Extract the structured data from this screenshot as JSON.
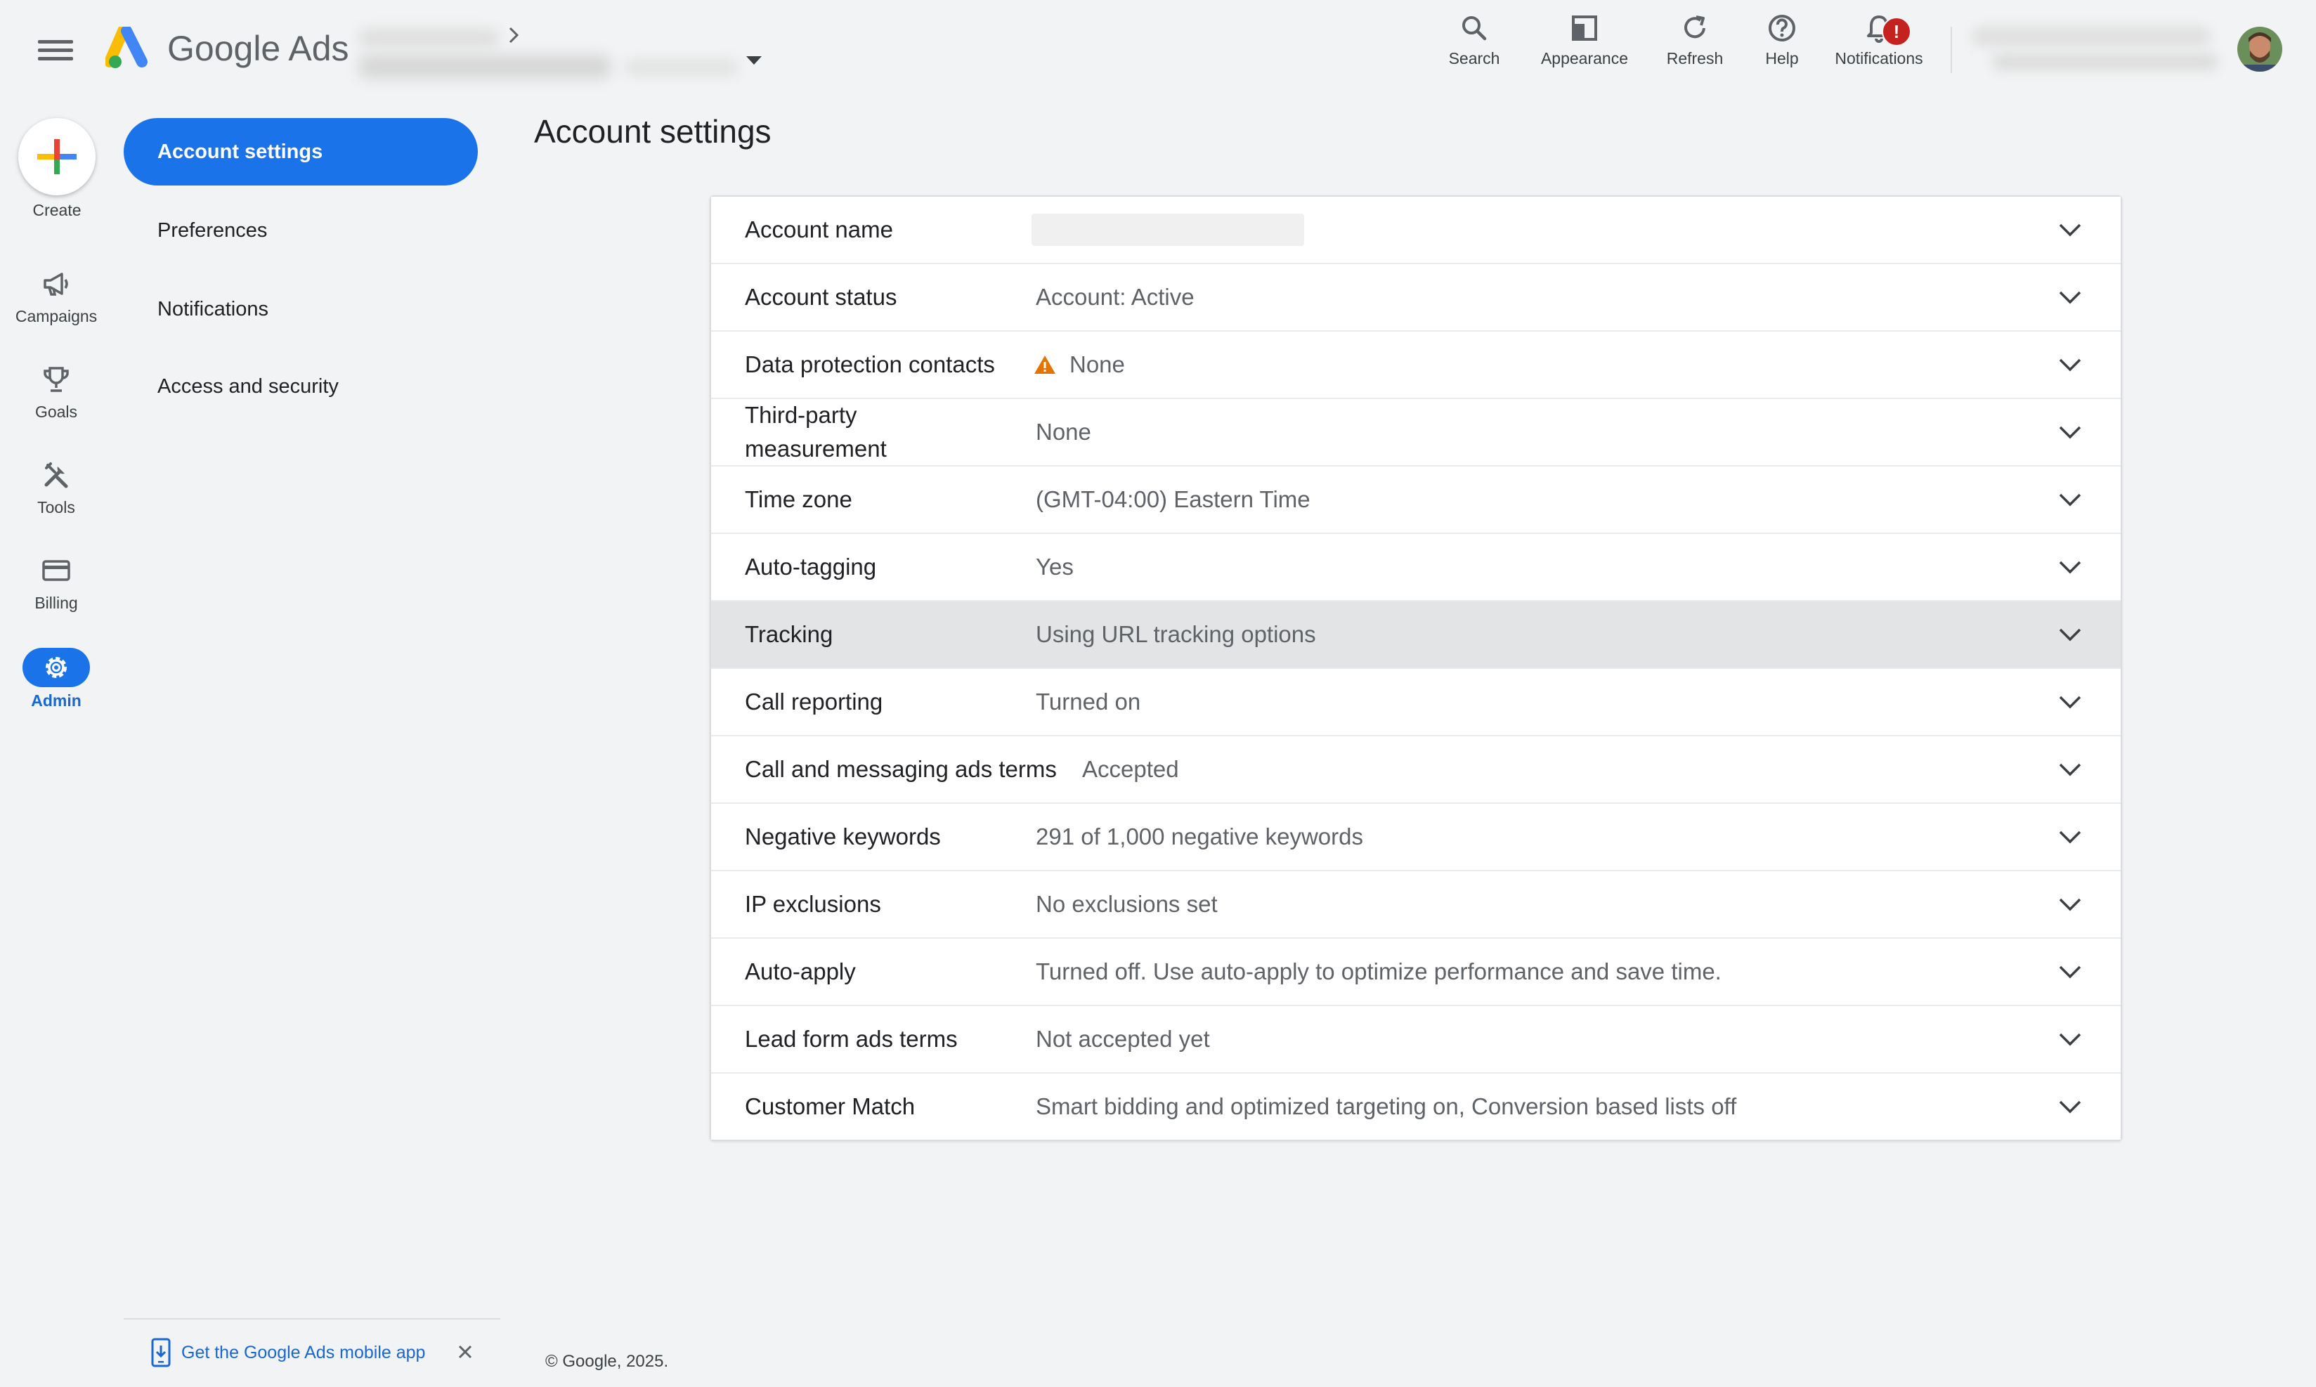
{
  "app": {
    "brand_google": "Google",
    "brand_ads": "Ads"
  },
  "toolbar": {
    "search_label": "Search",
    "appearance_label": "Appearance",
    "refresh_label": "Refresh",
    "help_label": "Help",
    "notifications_label": "Notifications",
    "notifications_badge": "!"
  },
  "rail": {
    "create": "Create",
    "campaigns": "Campaigns",
    "goals": "Goals",
    "tools": "Tools",
    "billing": "Billing",
    "admin": "Admin"
  },
  "subnav": {
    "account_settings": "Account settings",
    "preferences": "Preferences",
    "notifications": "Notifications",
    "access_security": "Access and security"
  },
  "main": {
    "title": "Account settings",
    "rows": [
      {
        "label": "Account name",
        "value": ""
      },
      {
        "label": "Account status",
        "value": "Account: Active"
      },
      {
        "label": "Data protection contacts",
        "value": "None"
      },
      {
        "label": "Third-party measurement",
        "value": "None"
      },
      {
        "label": "Time zone",
        "value": "(GMT-04:00) Eastern Time"
      },
      {
        "label": "Auto-tagging",
        "value": "Yes"
      },
      {
        "label": "Tracking",
        "value": "Using URL tracking options"
      },
      {
        "label": "Call reporting",
        "value": "Turned on"
      },
      {
        "label": "Call and messaging ads terms",
        "value": "Accepted"
      },
      {
        "label": "Negative keywords",
        "value": "291 of 1,000 negative keywords"
      },
      {
        "label": "IP exclusions",
        "value": "No exclusions set"
      },
      {
        "label": "Auto-apply",
        "value": "Turned off. Use auto-apply to optimize performance and save time."
      },
      {
        "label": "Lead form ads terms",
        "value": "Not accepted yet"
      },
      {
        "label": "Customer Match",
        "value": "Smart bidding and optimized targeting on, Conversion based lists off"
      }
    ]
  },
  "footer": {
    "mobile_app": "Get the Google Ads mobile app",
    "copyright": "© Google, 2025."
  },
  "colors": {
    "accent": "#1a73e8",
    "warning": "#e37400",
    "badge": "#c5221f",
    "background": "#f1f3f4"
  }
}
